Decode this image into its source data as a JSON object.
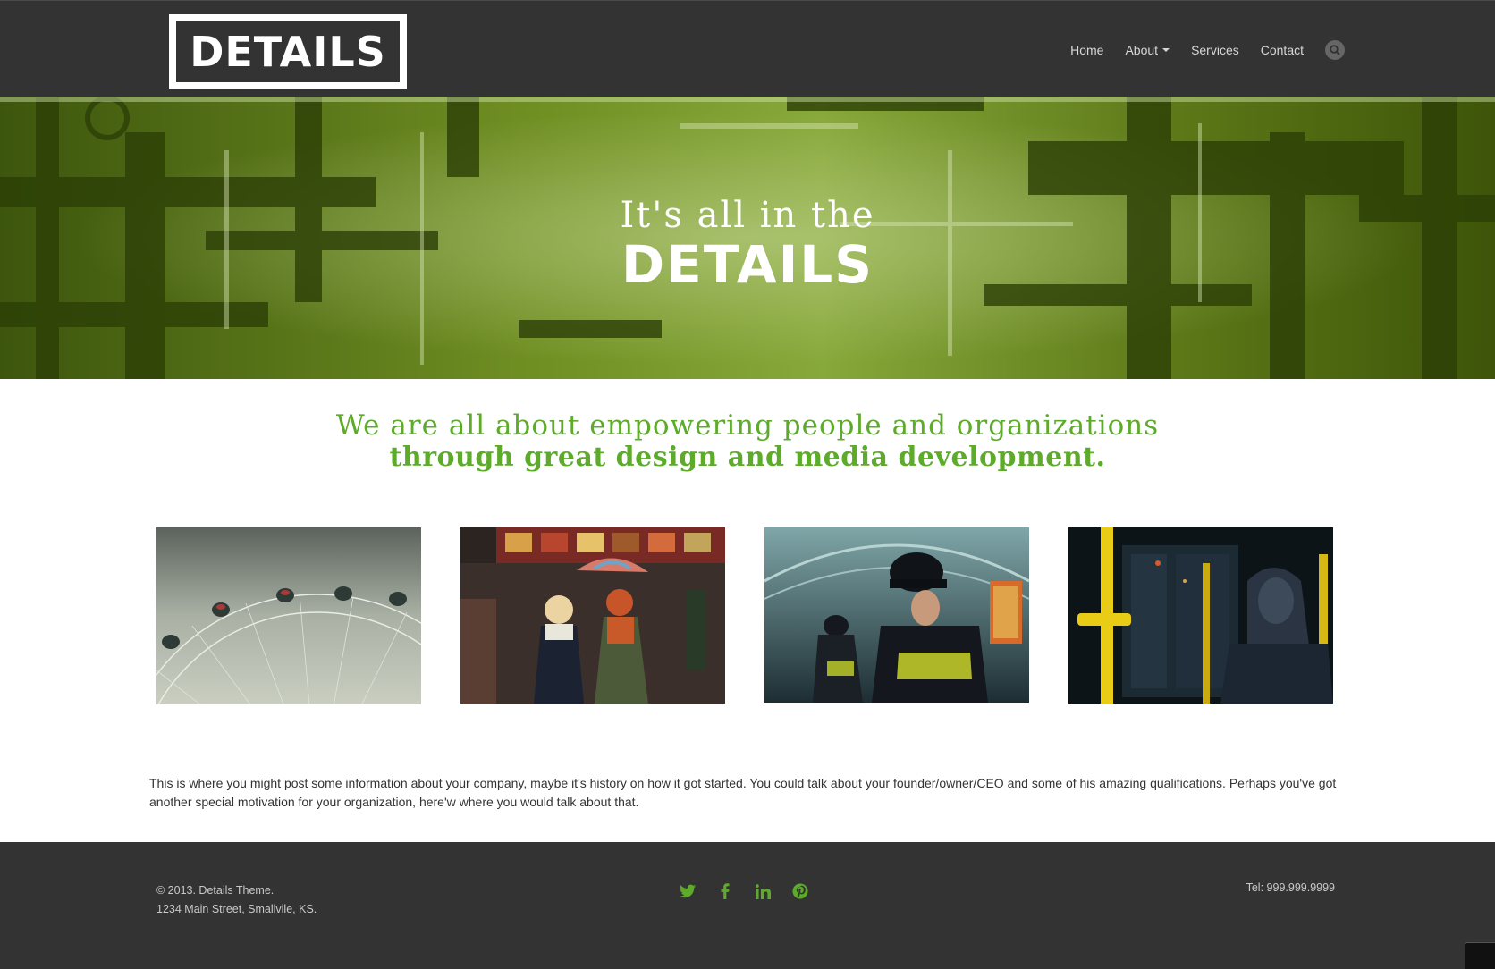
{
  "header": {
    "logo_text": "DETAILS",
    "nav": [
      {
        "label": "Home"
      },
      {
        "label": "About"
      },
      {
        "label": "Services"
      },
      {
        "label": "Contact"
      }
    ],
    "search_icon": "search-icon"
  },
  "hero": {
    "line1": "It's all in the",
    "line2": "DETAILS"
  },
  "tagline": {
    "line1": "We are all about empowering people and organizations",
    "line2": "through great design and media development."
  },
  "about_text": "This is where you might post some information about your company, maybe it's history on how it got started. You could talk about your founder/owner/CEO and some of his amazing qualifications. Perhaps you've got another special motivation for your organization, here'w where you would talk about that.",
  "footer": {
    "copyright": "© 2013. Details Theme.",
    "address": "1234 Main Street, Smallvile, KS.",
    "phone": "Tel: 999.999.9999",
    "social_icons": [
      "twitter-icon",
      "facebook-icon",
      "linkedin-icon",
      "pinterest-icon"
    ]
  },
  "colors": {
    "header_bg": "#333333",
    "accent_green": "#5eab2c",
    "hero_green": "#5b7a1a",
    "nav_text": "#d7d7d7"
  }
}
